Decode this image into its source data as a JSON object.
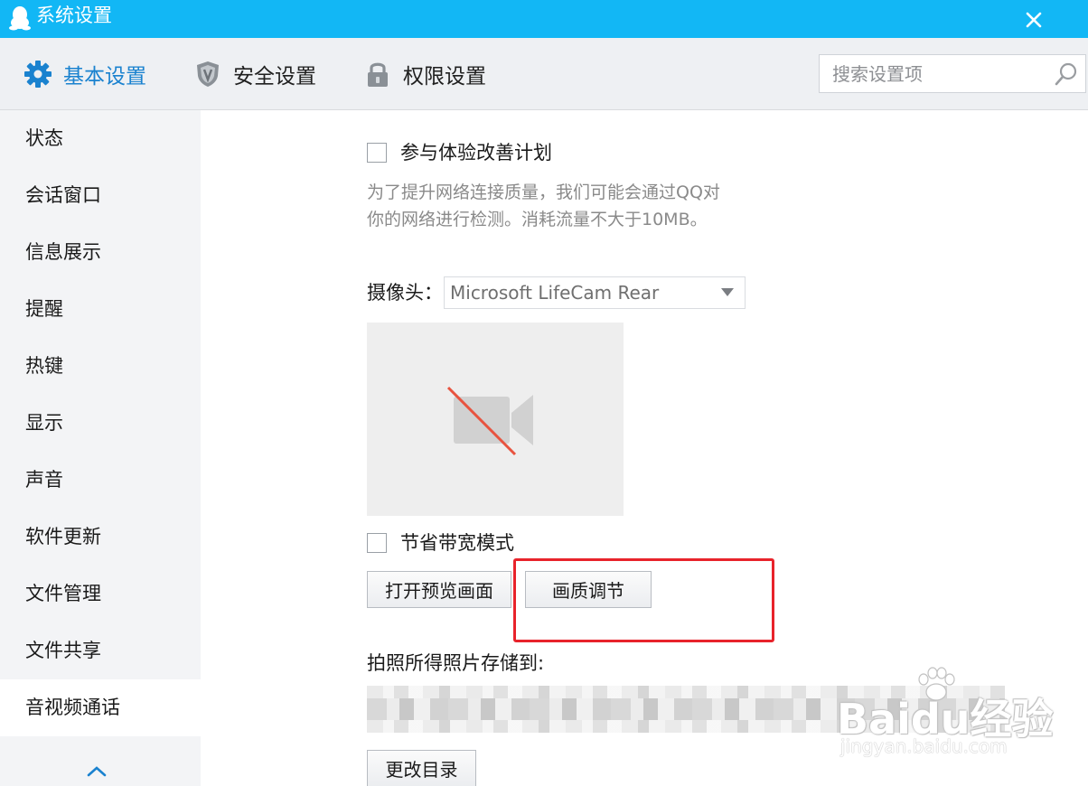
{
  "window": {
    "title": "系统设置",
    "title_bar_color": "#12b7f5",
    "accent_color": "#1a82cf",
    "highlight_color": "#e8232b"
  },
  "header": {
    "tabs": [
      {
        "label": "基本设置",
        "icon": "gear-icon",
        "active": true
      },
      {
        "label": "安全设置",
        "icon": "shield-icon",
        "active": false
      },
      {
        "label": "权限设置",
        "icon": "lock-icon",
        "active": false
      }
    ],
    "search": {
      "placeholder": "搜索设置项",
      "value": ""
    }
  },
  "sidebar": {
    "items": [
      {
        "label": "状态"
      },
      {
        "label": "会话窗口"
      },
      {
        "label": "信息展示"
      },
      {
        "label": "提醒"
      },
      {
        "label": "热键"
      },
      {
        "label": "显示"
      },
      {
        "label": "声音"
      },
      {
        "label": "软件更新"
      },
      {
        "label": "文件管理"
      },
      {
        "label": "文件共享"
      },
      {
        "label": "音视频通话",
        "active": true
      }
    ]
  },
  "main": {
    "experience": {
      "checkbox_label": "参与体验改善计划",
      "checked": false,
      "hint_line1": "为了提升网络连接质量，我们可能会通过QQ对",
      "hint_line2": "你的网络进行检测。消耗流量不大于10MB。"
    },
    "camera": {
      "label": "摄像头：",
      "selected": "Microsoft LifeCam Rear",
      "preview_icon": "camera-off-icon"
    },
    "bandwidth": {
      "checkbox_label": "节省带宽模式",
      "checked": false
    },
    "buttons": {
      "open_preview": "打开预览画面",
      "quality": "画质调节",
      "change_dir": "更改目录"
    },
    "photo_storage": {
      "label": "拍照所得照片存储到:"
    }
  },
  "watermark": {
    "brand": "Baidu经验",
    "url": "jingyan.baidu.com"
  }
}
